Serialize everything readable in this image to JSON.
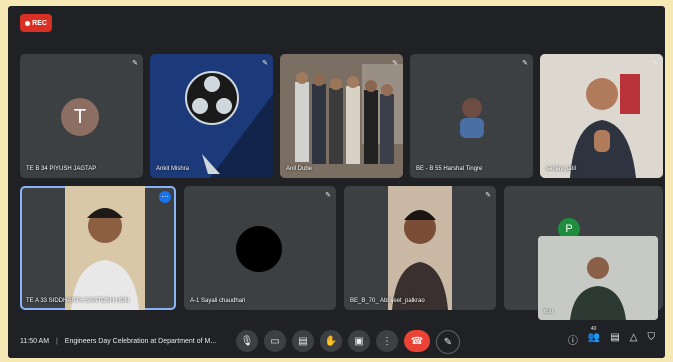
{
  "recording": {
    "label": "REC"
  },
  "tiles": [
    {
      "name": "TE B 34 PIYUSH JAGTAP",
      "avatar_letter": "T"
    },
    {
      "name": "Ankit Mishra"
    },
    {
      "name": "Anil Dube"
    },
    {
      "name": "BE - B 55 Harshal Tingre"
    },
    {
      "name": "sanjay patil"
    },
    {
      "name": "TE A 33 SIDDHARTH SANTOSH HON"
    },
    {
      "name": "A-1 Sayali chaudhari"
    },
    {
      "name": "BE_B_70_ Abhijeet_palkrao"
    },
    {
      "name": "You",
      "avatar_letter": "P"
    }
  ],
  "bottom": {
    "time": "11:50 AM",
    "meeting_title": "Engineers Day Celebration at Department of M..."
  },
  "participants_count": "40",
  "colors": {
    "rec": "#d93025",
    "end_call": "#ea4335",
    "tile_bg": "#3c4043",
    "accent": "#1a73e8"
  }
}
